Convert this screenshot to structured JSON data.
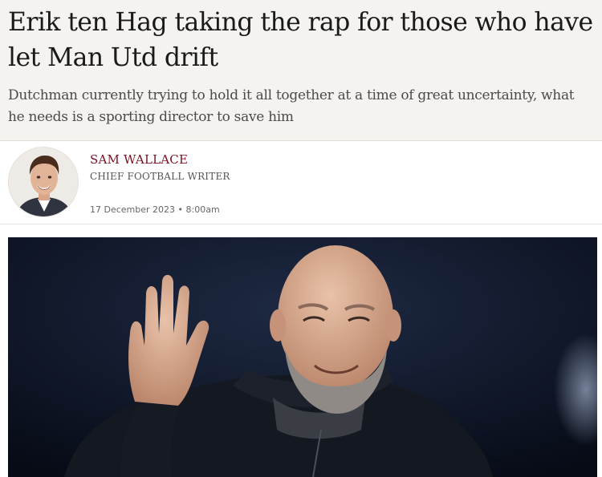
{
  "article": {
    "headline": "Erik ten Hag taking the rap for those who have let Man Utd drift",
    "standfirst": "Dutchman currently trying to hold it all together at a time of great uncertainty, what he needs is a sporting director to save him"
  },
  "byline": {
    "author_name": "SAM WALLACE",
    "author_role": "CHIEF FOOTBALL WRITER",
    "date": "17 December 2023 • 8:00am"
  },
  "colors": {
    "header_background": "#f5f3f0",
    "author_accent": "#7a1022",
    "photo_background": "#0d1526"
  },
  "icons": {
    "author_avatar": "author-portrait",
    "lead_image": "manager-waving-photo"
  }
}
